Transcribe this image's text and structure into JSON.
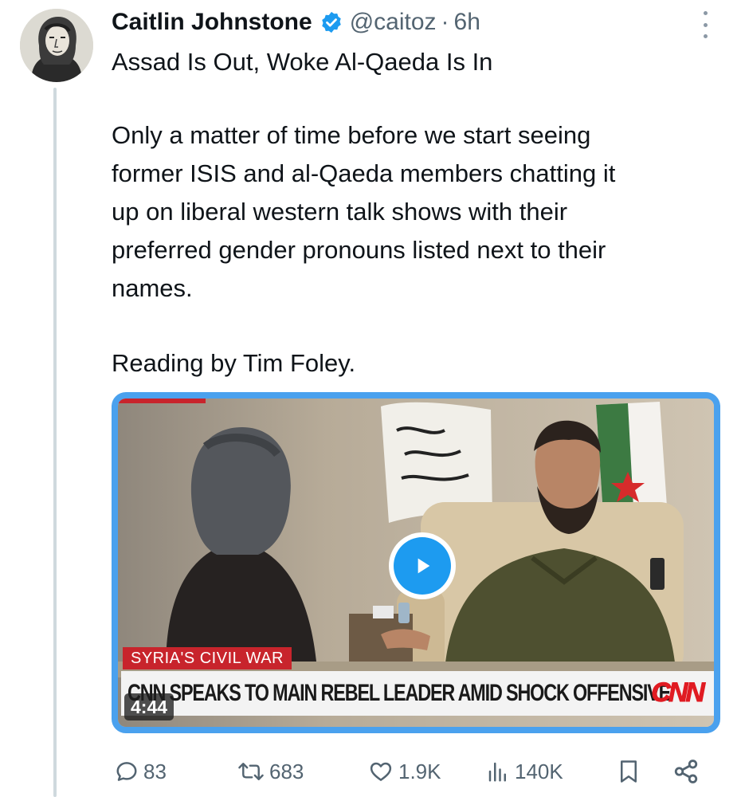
{
  "author": {
    "display_name": "Caitlin Johnstone",
    "handle": "@caitoz",
    "separator": "·",
    "time": "6h",
    "verified": true
  },
  "tweet": {
    "title": "Assad Is Out, Woke Al-Qaeda Is In",
    "body_lines": [
      "Only a matter of time before we start seeing",
      "former ISIS and al-Qaeda members chatting it",
      "up on liberal western talk shows with their",
      "preferred gender pronouns listed next to their",
      "names."
    ],
    "credit": "Reading by Tim Foley."
  },
  "video": {
    "topic_banner": "SYRIA'S CIVIL WAR",
    "headline": "CNN SPEAKS TO MAIN REBEL LEADER AMID SHOCK OFFENSIVE",
    "network_logo": "CNN",
    "duration": "4:44"
  },
  "actions": {
    "replies": "83",
    "reposts": "683",
    "likes": "1.9K",
    "views": "140K"
  },
  "icons": {
    "verified": "verified-badge-icon",
    "more": "more-vertical-icon",
    "reply": "reply-icon",
    "repost": "repost-icon",
    "like": "heart-icon",
    "views": "views-icon",
    "bookmark": "bookmark-icon",
    "share": "share-icon",
    "play": "play-icon"
  },
  "colors": {
    "accent": "#1d9bf0",
    "text": "#0f1419",
    "muted": "#536471",
    "media_border": "#4aa1ee",
    "cnn_red": "#e01b22"
  }
}
